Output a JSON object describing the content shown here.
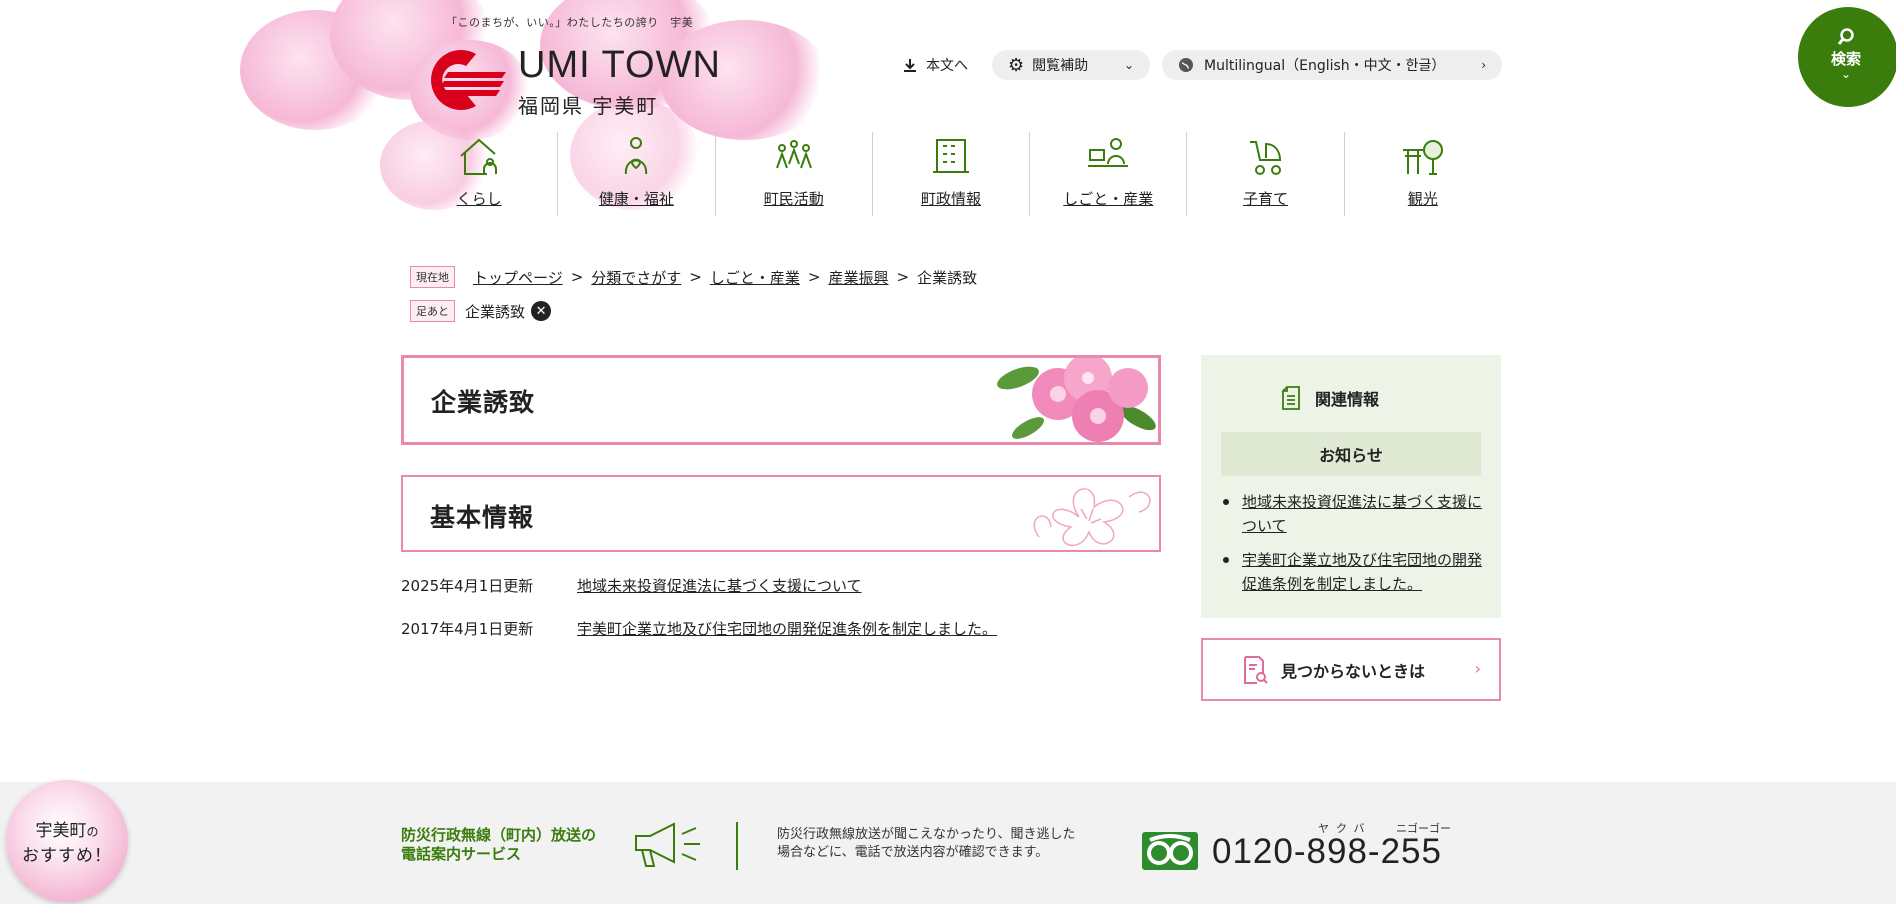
{
  "header": {
    "tagline": "「このまちが、いい。」わたしたちの誇り　宇美",
    "logo_en": "UMI TOWN",
    "logo_ja": "福岡県 宇美町",
    "utility": {
      "honbun": "本文へ",
      "hojo": "閲覧補助",
      "multilingual": "Multilingual（English・中文・한글）"
    },
    "search_label": "検索"
  },
  "nav": {
    "items": [
      {
        "label": "くらし",
        "icon": "house-person-icon"
      },
      {
        "label": "健康・福祉",
        "icon": "health-person-icon"
      },
      {
        "label": "町民活動",
        "icon": "people-group-icon"
      },
      {
        "label": "町政情報",
        "icon": "building-icon"
      },
      {
        "label": "しごと・産業",
        "icon": "worker-desk-icon"
      },
      {
        "label": "子育て",
        "icon": "stroller-icon"
      },
      {
        "label": "観光",
        "icon": "torii-tree-icon"
      }
    ]
  },
  "breadcrumb": {
    "current_tag": "現在地",
    "items": [
      "トップページ",
      "分類でさがす",
      "しごと・産業",
      "産業振興"
    ],
    "current": "企業誘致",
    "footprint_tag": "足あと",
    "footprint_item": "企業誘致"
  },
  "main": {
    "title": "企業誘致",
    "section_title": "基本情報",
    "news": [
      {
        "date": "2025年4月1日更新",
        "title": "地域未来投資促進法に基づく支援について"
      },
      {
        "date": "2017年4月1日更新",
        "title": "宇美町企業立地及び住宅団地の開発促進条例を制定しました。"
      }
    ]
  },
  "sidebar": {
    "heading": "関連情報",
    "subheading": "お知らせ",
    "links": [
      "地域未来投資促進法に基づく支援について",
      "宇美町企業立地及び住宅団地の開発促進条例を制定しました。"
    ],
    "notfound": "見つからないときは"
  },
  "footer": {
    "recommend_line1": "宇美町",
    "recommend_no": "の",
    "recommend_line2": "おすすめ！",
    "service_title_1": "防災行政無線（町内）放送の",
    "service_title_2": "電話案内サービス",
    "desc_1": "防災行政無線放送が聞こえなかったり、聞き逃した",
    "desc_2": "場合などに、電話で放送内容が確認できます。",
    "phone": "0120-898-255",
    "phone_kana_1": "ヤクバ",
    "phone_kana_2": "ニゴーゴー"
  },
  "colors": {
    "accent_green": "#3a7d0c",
    "accent_pink": "#e989ac",
    "sidebar_bg": "#eef3e8",
    "logo_red": "#d9001b"
  }
}
